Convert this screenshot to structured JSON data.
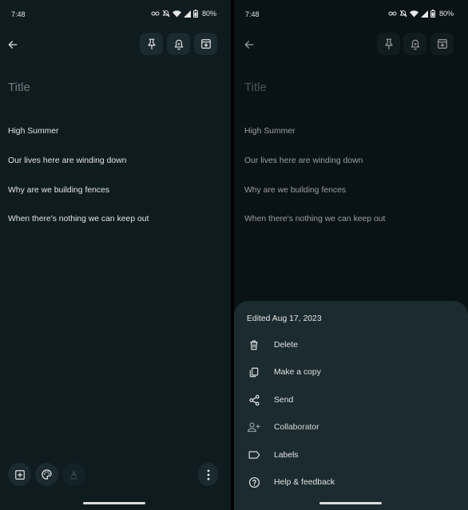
{
  "status_bar": {
    "time": "7:48",
    "battery": "80%"
  },
  "editor": {
    "title_placeholder": "Title",
    "lines": [
      "High Summer",
      "Our lives here are winding down",
      "Why are we building fences",
      "When there's nothing we can keep out"
    ]
  },
  "toolbar": {
    "icons": [
      "back-arrow-icon",
      "pin-icon",
      "reminder-bell-icon",
      "archive-icon"
    ]
  },
  "bottom_bar": {
    "icons": [
      "add-box-icon",
      "palette-icon",
      "text-format-icon",
      "more-vert-icon"
    ]
  },
  "menu_sheet": {
    "edited": "Edited Aug 17, 2023",
    "items": [
      {
        "icon": "trash-icon",
        "label": "Delete"
      },
      {
        "icon": "copy-icon",
        "label": "Make a copy"
      },
      {
        "icon": "share-icon",
        "label": "Send"
      },
      {
        "icon": "person-add-icon",
        "label": "Collaborator"
      },
      {
        "icon": "label-icon",
        "label": "Labels"
      },
      {
        "icon": "help-icon",
        "label": "Help & feedback"
      }
    ]
  },
  "colors": {
    "background": "#0e1b1f",
    "sheet": "#1b2b2f",
    "button": "#1a2a2e",
    "text": "#e2e4e4",
    "placeholder": "#6e7c80"
  }
}
